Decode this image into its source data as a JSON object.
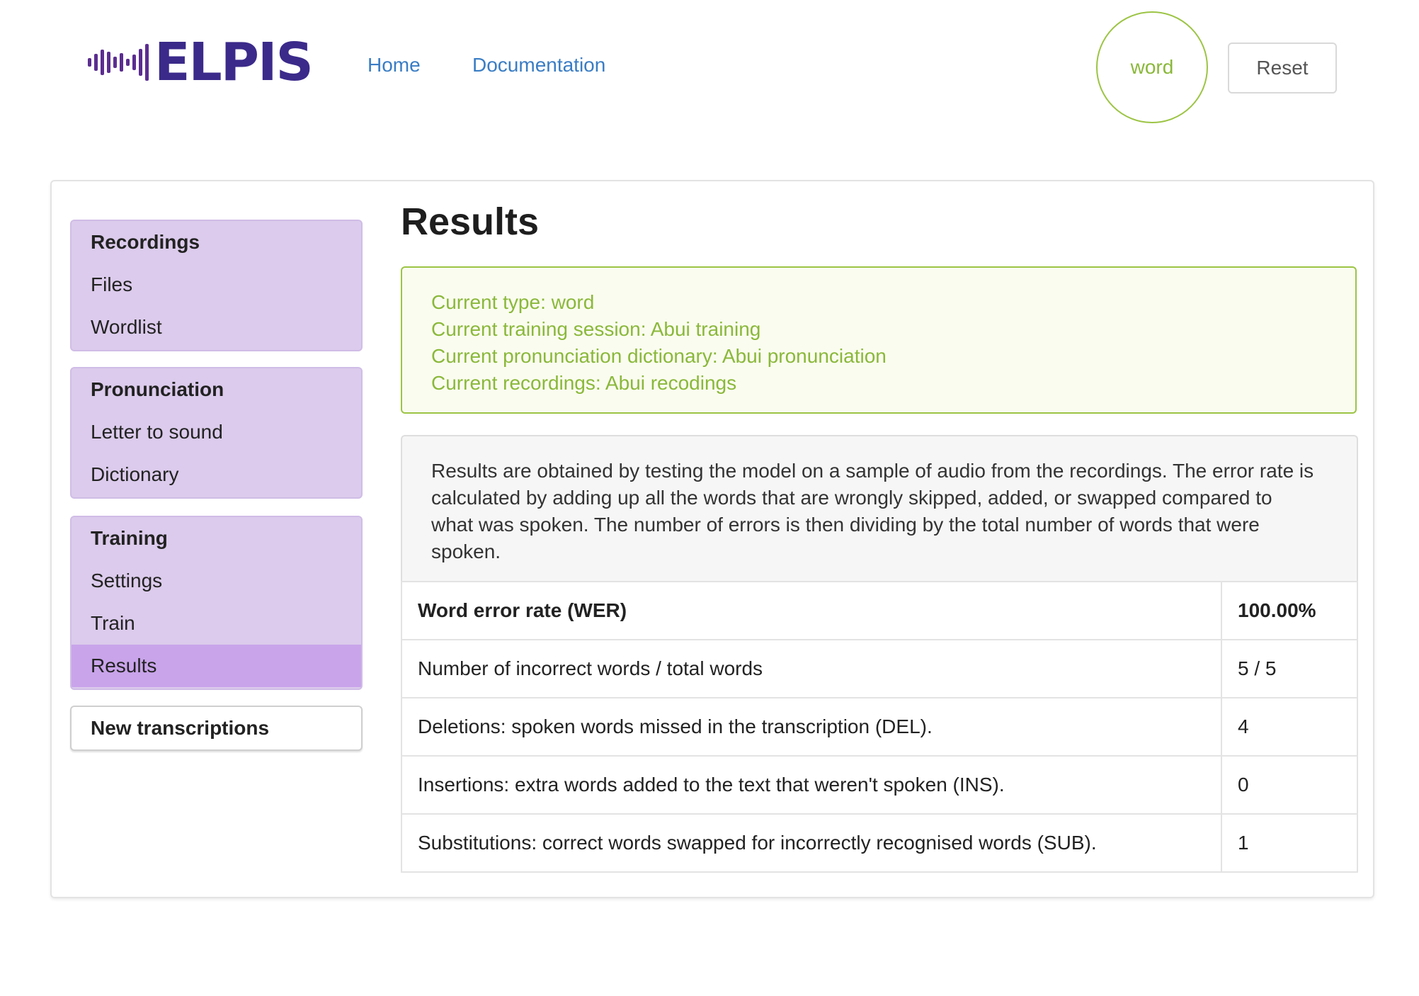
{
  "header": {
    "logo_text": "ELPIS",
    "nav": {
      "home": "Home",
      "documentation": "Documentation"
    },
    "type_badge": "word",
    "reset_label": "Reset"
  },
  "colors": {
    "accent_purple": "#dccbec",
    "active_purple": "#c9a4ea",
    "info_green": "#8ab83a",
    "link_blue": "#3a7dc4"
  },
  "sidebar": {
    "groups": [
      {
        "heading": "Recordings",
        "items": [
          "Files",
          "Wordlist"
        ]
      },
      {
        "heading": "Pronunciation",
        "items": [
          "Letter to sound",
          "Dictionary"
        ]
      },
      {
        "heading": "Training",
        "items": [
          "Settings",
          "Train",
          "Results"
        ]
      }
    ],
    "active_item": "Results",
    "new_transcriptions": "New transcriptions"
  },
  "main": {
    "title": "Results",
    "info": {
      "type": "Current type: word",
      "session": "Current training session: Abui training",
      "dictionary": "Current pronunciation dictionary: Abui pronunciation",
      "recordings": "Current recordings: Abui recodings"
    },
    "description": "Results are obtained by testing the model on a sample of audio from the recordings. The error rate is calculated by adding up all the words that are wrongly skipped, added, or swapped compared to what was spoken. The number of errors is then dividing by the total number of words that were spoken.",
    "table": [
      {
        "label": "Word error rate (WER)",
        "value": "100.00%"
      },
      {
        "label": "Number of incorrect words / total words",
        "value": "5 / 5"
      },
      {
        "label": "Deletions: spoken words missed in the transcription (DEL).",
        "value": "4"
      },
      {
        "label": "Insertions: extra words added to the text that weren't spoken (INS).",
        "value": "0"
      },
      {
        "label": "Substitutions: correct words swapped for incorrectly recognised words (SUB).",
        "value": "1"
      }
    ]
  }
}
